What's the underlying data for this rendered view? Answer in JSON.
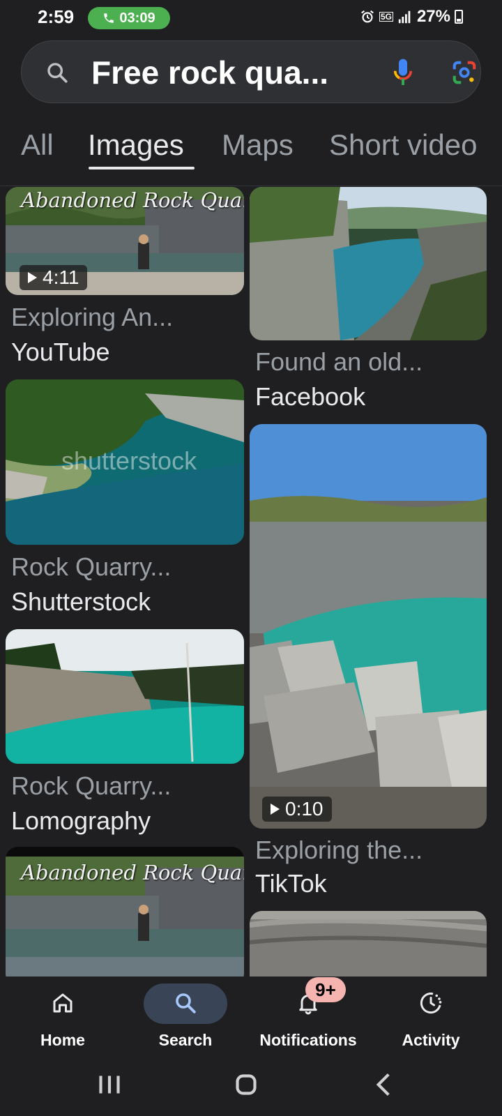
{
  "status_bar": {
    "time": "2:59",
    "call_timer": "03:09",
    "network": "5G",
    "battery": "27%"
  },
  "search": {
    "query": "Free rock qua..."
  },
  "tabs": [
    {
      "label": "All"
    },
    {
      "label": "Images",
      "active": true
    },
    {
      "label": "Maps"
    },
    {
      "label": "Short video"
    }
  ],
  "results": [
    {
      "title": "Exploring An...",
      "source": "YouTube",
      "duration": "4:11",
      "overlay_text": "Abandoned Rock Quarry"
    },
    {
      "title": "Found an old...",
      "source": "Facebook"
    },
    {
      "title": "Rock Quarry...",
      "source": "Shutterstock",
      "watermark": "shutterstock"
    },
    {
      "title": "Exploring the...",
      "source": "TikTok",
      "duration": "0:10"
    },
    {
      "title": "Rock Quarry...",
      "source": "Lomography"
    },
    {
      "overlay_text": "Abandoned Rock Quarry"
    }
  ],
  "bottom_nav": [
    {
      "label": "Home",
      "icon": "home-icon"
    },
    {
      "label": "Search",
      "icon": "search-icon",
      "active": true
    },
    {
      "label": "Notifications",
      "icon": "bell-icon",
      "badge": "9+"
    },
    {
      "label": "Activity",
      "icon": "activity-icon"
    }
  ],
  "colors": {
    "background": "#1f1f21",
    "active_nav_pill": "#394457",
    "badge": "#f6b4b0",
    "call_pill": "#4caf50"
  }
}
